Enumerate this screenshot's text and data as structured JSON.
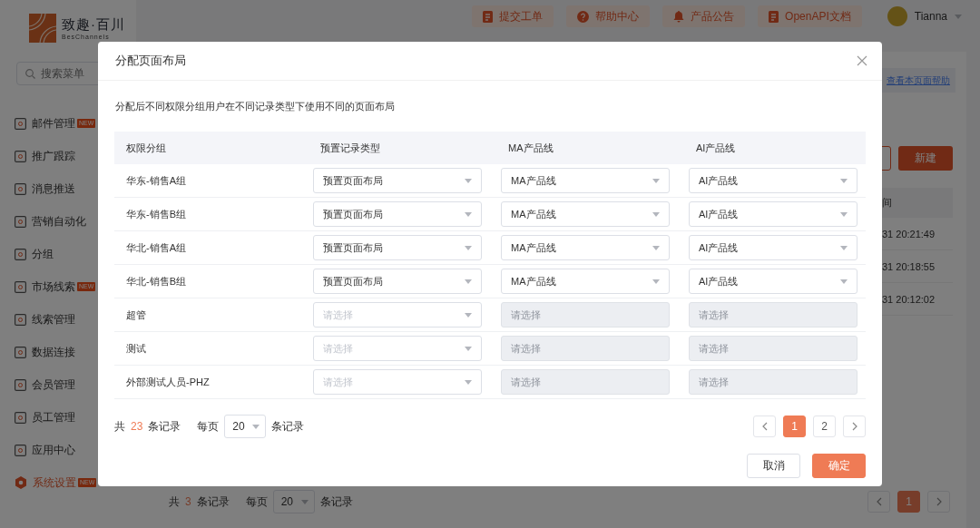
{
  "app": {
    "logo_text": "致趣·百川",
    "logo_subtext": "BesChannels"
  },
  "top_actions": [
    {
      "label": "提交工单",
      "kind": "doc"
    },
    {
      "label": "帮助中心",
      "kind": "help"
    },
    {
      "label": "产品公告",
      "kind": "bell"
    },
    {
      "label": "OpenAPI文档",
      "kind": "doc"
    }
  ],
  "user": {
    "name": "Tianna"
  },
  "search": {
    "placeholder": "搜索菜单"
  },
  "sidebar": {
    "items": [
      {
        "label": "邮件管理",
        "badge": "NEW",
        "selected": false
      },
      {
        "label": "推广跟踪",
        "selected": false
      },
      {
        "label": "消息推送",
        "selected": false
      },
      {
        "label": "营销自动化",
        "selected": false
      },
      {
        "label": "分组",
        "selected": false
      },
      {
        "label": "市场线索",
        "badge": "NEW",
        "selected": false
      },
      {
        "label": "线索管理",
        "selected": false
      },
      {
        "label": "数据连接",
        "selected": false
      },
      {
        "label": "会员管理",
        "selected": false
      },
      {
        "label": "员工管理",
        "selected": false
      },
      {
        "label": "应用中心",
        "selected": false
      },
      {
        "label": "系统设置",
        "badge": "NEW",
        "selected": true
      }
    ]
  },
  "page": {
    "help_link": "查看本页面帮助",
    "new_button": "新建",
    "table": {
      "column_header": "间",
      "rows": [
        "31 20:21:49",
        "31 20:18:55",
        "31 20:12:02"
      ]
    },
    "pagination": {
      "prefix": "共",
      "total": "3",
      "suffix": "条记录",
      "per_page_label": "每页",
      "per_page": "20",
      "per_page_suffix": "条记录",
      "pages": [
        {
          "label": "1",
          "selected": true
        }
      ]
    }
  },
  "dialog": {
    "title": "分配页面布局",
    "description": "分配后不同权限分组用户在不同记录类型下使用不同的页面布局",
    "columns": [
      "权限分组",
      "预置记录类型",
      "MA产品线",
      "AI产品线"
    ],
    "rows": [
      {
        "group": "华东-销售A组",
        "selects": [
          {
            "value": "预置页面布局",
            "disabled": false
          },
          {
            "value": "MA产品线",
            "disabled": false
          },
          {
            "value": "AI产品线",
            "disabled": false
          }
        ]
      },
      {
        "group": "华东-销售B组",
        "selects": [
          {
            "value": "预置页面布局",
            "disabled": false
          },
          {
            "value": "MA产品线",
            "disabled": false
          },
          {
            "value": "AI产品线",
            "disabled": false
          }
        ]
      },
      {
        "group": "华北-销售A组",
        "selects": [
          {
            "value": "预置页面布局",
            "disabled": false
          },
          {
            "value": "MA产品线",
            "disabled": false
          },
          {
            "value": "AI产品线",
            "disabled": false
          }
        ]
      },
      {
        "group": "华北-销售B组",
        "selects": [
          {
            "value": "预置页面布局",
            "disabled": false
          },
          {
            "value": "MA产品线",
            "disabled": false
          },
          {
            "value": "AI产品线",
            "disabled": false
          }
        ]
      },
      {
        "group": "超管",
        "selects": [
          {
            "placeholder": "请选择",
            "disabled": false
          },
          {
            "placeholder": "请选择",
            "disabled": true
          },
          {
            "placeholder": "请选择",
            "disabled": true
          }
        ]
      },
      {
        "group": "测试",
        "selects": [
          {
            "placeholder": "请选择",
            "disabled": false
          },
          {
            "placeholder": "请选择",
            "disabled": true
          },
          {
            "placeholder": "请选择",
            "disabled": true
          }
        ]
      },
      {
        "group": "外部测试人员-PHZ",
        "selects": [
          {
            "placeholder": "请选择",
            "disabled": false
          },
          {
            "placeholder": "请选择",
            "disabled": true
          },
          {
            "placeholder": "请选择",
            "disabled": true
          }
        ]
      }
    ],
    "pagination": {
      "prefix": "共",
      "total": "23",
      "suffix": "条记录",
      "per_page_label": "每页",
      "per_page": "20",
      "per_page_suffix": "条记录",
      "pages": [
        {
          "label": "1",
          "selected": true
        },
        {
          "label": "2",
          "selected": false
        }
      ]
    },
    "buttons": [
      {
        "label": "取消",
        "kind": "secondary"
      },
      {
        "label": "确定",
        "kind": "primary"
      }
    ]
  }
}
